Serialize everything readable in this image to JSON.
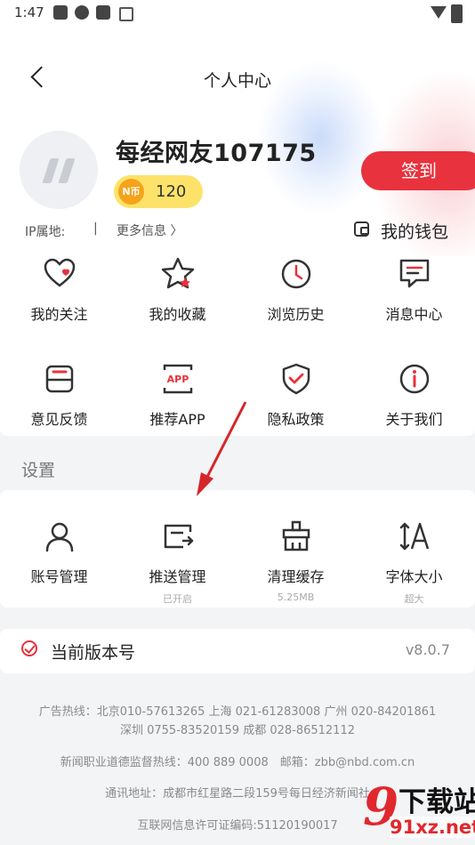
{
  "status_bar": {
    "time": "1:47"
  },
  "header": {
    "title": "个人中心",
    "username": "每经网友107175",
    "coin_badge": "N币",
    "coin_value": "120",
    "checkin_label": "签到",
    "ip_label": "IP属地:",
    "ip_separator": "|",
    "more_info": "更多信息 〉",
    "wallet_label": "我的钱包"
  },
  "menu": {
    "items": [
      {
        "label": "我的关注",
        "icon": "heart-icon"
      },
      {
        "label": "我的收藏",
        "icon": "star-icon"
      },
      {
        "label": "浏览历史",
        "icon": "clock-icon"
      },
      {
        "label": "消息中心",
        "icon": "message-icon"
      },
      {
        "label": "意见反馈",
        "icon": "feedback-icon"
      },
      {
        "label": "推荐APP",
        "icon": "app-icon",
        "icon_text": "APP"
      },
      {
        "label": "隐私政策",
        "icon": "shield-icon"
      },
      {
        "label": "关于我们",
        "icon": "info-icon"
      }
    ]
  },
  "settings": {
    "section_title": "设置",
    "items": [
      {
        "label": "账号管理",
        "sub": "",
        "icon": "user-icon"
      },
      {
        "label": "推送管理",
        "sub": "已开启",
        "icon": "push-icon"
      },
      {
        "label": "清理缓存",
        "sub": "5.25MB",
        "icon": "broom-icon"
      },
      {
        "label": "字体大小",
        "sub": "超大",
        "icon": "font-size-icon"
      }
    ]
  },
  "version": {
    "label": "当前版本号",
    "value": "v8.0.7"
  },
  "footer": {
    "ad_hotline_1": "广告热线：北京010-57613265 上海 021-61283008 广州 020-84201861",
    "ad_hotline_2": "深圳 0755-83520159 成都 028-86512112",
    "ethics_hotline": "新闻职业道德监督热线：400 889 0008　邮箱：zbb@nbd.com.cn",
    "address": "通讯地址：成都市红星路二段159号每日经济新闻社",
    "license": "互联网信息许可证编码:51120190017"
  },
  "watermark": {
    "big": "9",
    "text": "下载站",
    "url": "91xz.net"
  },
  "colors": {
    "accent": "#e8323d",
    "coin": "#fde26a",
    "background": "#f3f4f6"
  }
}
